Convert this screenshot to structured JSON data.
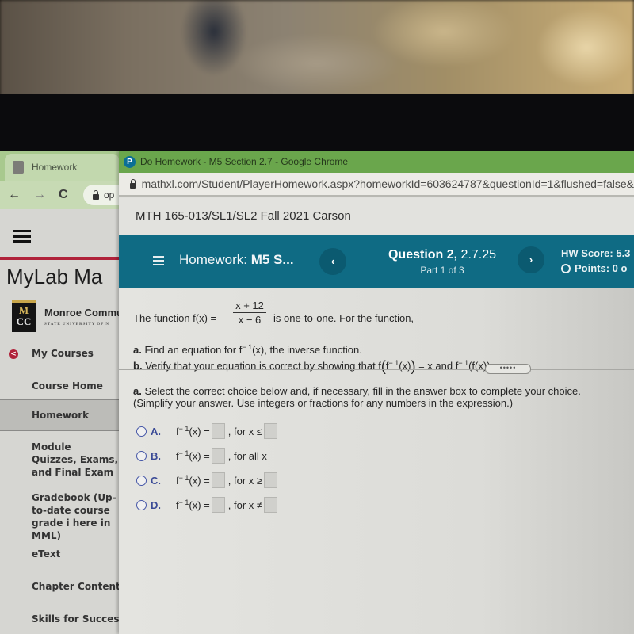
{
  "back_window": {
    "tab_title": "Homework",
    "omnibox_text": "op",
    "site_title": "MyLab Ma",
    "school": {
      "logo_top": "M",
      "logo_bottom": "CC",
      "name": "Monroe Commu",
      "subtitle": "STATE UNIVERSITY OF N"
    },
    "nav": {
      "back_label": "My Courses",
      "items": [
        {
          "label": "Course Home",
          "active": false
        },
        {
          "label": "Homework",
          "active": true
        },
        {
          "label": "Module Quizzes, Exams, and Final Exam",
          "active": false
        },
        {
          "label": "Gradebook (Up-to-date course grade i here in MML)",
          "active": false
        },
        {
          "label": "eText",
          "active": false
        },
        {
          "label": "Chapter Contents",
          "active": false
        },
        {
          "label": "Skills for Success",
          "active": false
        }
      ]
    },
    "icons": {
      "back": "←",
      "forward": "→",
      "reload": "C",
      "back_nav": "<"
    }
  },
  "front_window": {
    "window_title": "Do Homework - M5 Section 2.7 - Google Chrome",
    "favicon_letter": "P",
    "url": "mathxl.com/Student/PlayerHomework.aspx?homeworkId=603624787&questionId=1&flushed=false&",
    "course": "MTH 165-013/SL1/SL2 Fall 2021 Carson",
    "header": {
      "homework_prefix": "Homework:",
      "homework_name": "M5 S...",
      "prev_label": "‹",
      "next_label": "›",
      "question_bold": "Question 2,",
      "question_id": "2.7.25",
      "part": "Part 1 of 3",
      "hw_score": "HW Score: 5.3",
      "points": "Points: 0 o"
    },
    "question": {
      "lead": "The function f(x) =",
      "numerator": "x + 12",
      "denominator": "x − 6",
      "tail": "is one-to-one. For the function,",
      "part_a_label": "a.",
      "part_a_text_1": "Find an equation for f",
      "part_a_text_2": "(x), the inverse function.",
      "part_b_label": "b.",
      "part_b_text_1": "Verify that your equation is correct by showing that f",
      "part_b_text_2": "= x and f",
      "part_b_text_3": "(f(x)) = x.",
      "inverse_sup": "− 1",
      "more_label": "•••••",
      "instr_label": "a.",
      "instr_line_1": "Select the correct choice below and, if necessary, fill in the answer box to complete your choice.",
      "instr_line_2": "(Simplify your answer. Use integers or fractions for any numbers in the expression.)"
    },
    "choices": [
      {
        "letter": "A.",
        "lhs": "(x) =",
        "condition": ", for x ≤",
        "has_second_box": true,
        "selected": false
      },
      {
        "letter": "B.",
        "lhs": "(x) =",
        "condition": ", for all x",
        "has_second_box": false,
        "selected": false
      },
      {
        "letter": "C.",
        "lhs": "(x) =",
        "condition": ", for x ≥",
        "has_second_box": true,
        "selected": false
      },
      {
        "letter": "D.",
        "lhs": "(x) =",
        "condition": ", for x ≠",
        "has_second_box": true,
        "selected": false
      }
    ],
    "colors": {
      "header_teal": "#0f6b84",
      "chrome_green": "#6aa64c",
      "mylab_red": "#b0223a",
      "choice_blue": "#3a4a96"
    }
  }
}
